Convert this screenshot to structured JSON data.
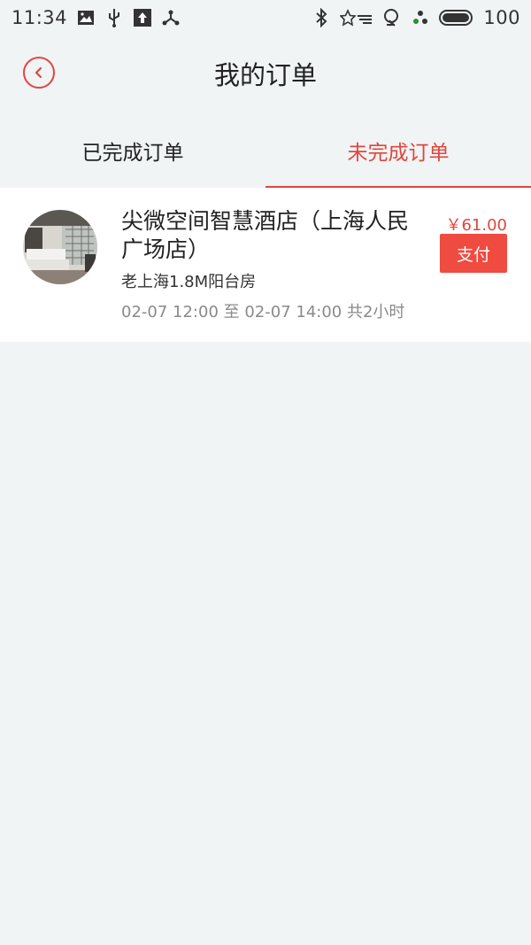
{
  "status_bar": {
    "time": "11:34",
    "battery": "100",
    "left_icons": [
      "image-icon",
      "usb-icon",
      "upload-icon",
      "share-icon"
    ],
    "right_icons": [
      "bluetooth-icon",
      "star-wifi-icon",
      "location-icon",
      "signal-icon",
      "battery-icon"
    ]
  },
  "header": {
    "title": "我的订单",
    "back_icon": "chevron-left-icon"
  },
  "tabs": [
    {
      "label": "已完成订单",
      "active": false
    },
    {
      "label": "未完成订单",
      "active": true
    }
  ],
  "orders": [
    {
      "hotel_name": "尖微空间智慧酒店（上海人民广场店）",
      "room_type": "老上海1.8M阳台房",
      "time_range": "02-07 12:00 至 02-07 14:00 共2小时",
      "price": "￥61.00",
      "pay_label": "支付"
    }
  ],
  "colors": {
    "accent": "#e0463e",
    "background": "#f0f4f5",
    "button": "#ef4b40"
  }
}
